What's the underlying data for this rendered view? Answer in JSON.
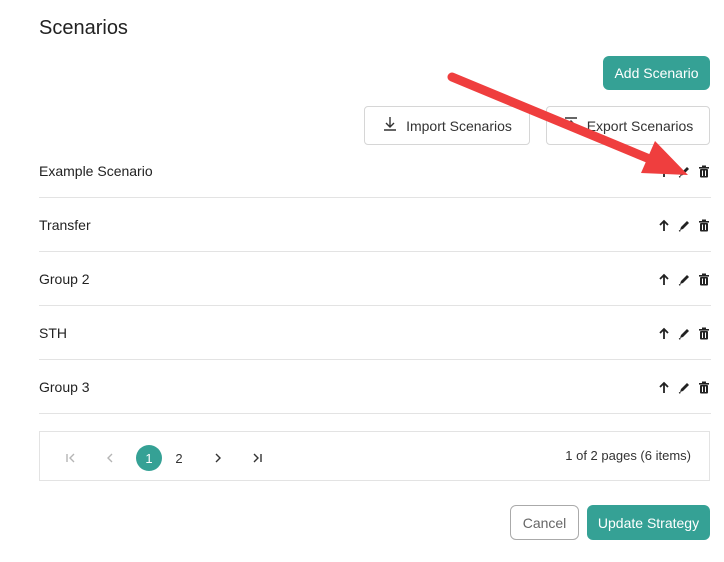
{
  "page": {
    "title": "Scenarios"
  },
  "toolbar": {
    "add_label": "Add Scenario",
    "import_label": "Import Scenarios",
    "export_label": "Export Scenarios"
  },
  "scenarios": [
    {
      "name": "Example Scenario"
    },
    {
      "name": "Transfer"
    },
    {
      "name": "Group 2"
    },
    {
      "name": "STH"
    },
    {
      "name": "Group 3"
    }
  ],
  "pagination": {
    "pages": [
      "1",
      "2"
    ],
    "current_page": "1",
    "info": "1 of 2 pages (6 items)"
  },
  "footer": {
    "cancel_label": "Cancel",
    "update_label": "Update Strategy"
  },
  "colors": {
    "accent": "#35a195",
    "annotation_arrow": "#ef3e3e"
  }
}
